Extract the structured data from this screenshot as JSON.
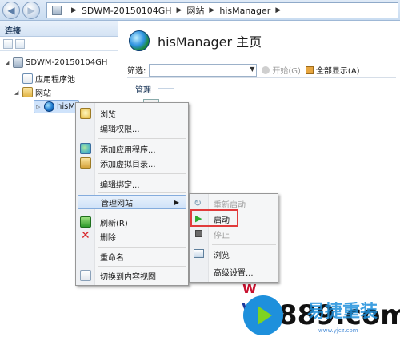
{
  "address_bar": {
    "segments": [
      "SDWM-20150104GH",
      "网站",
      "hisManager"
    ]
  },
  "connections_panel": {
    "title": "连接",
    "tree": [
      {
        "label": "SDWM-20150104GH",
        "icon": "server-icon"
      },
      {
        "label": "应用程序池",
        "icon": "app-pool-icon"
      },
      {
        "label": "网站",
        "icon": "sites-folder-icon"
      },
      {
        "label": "hisM",
        "icon": "globe-icon"
      }
    ]
  },
  "main": {
    "title": "hisManager 主页",
    "filter_label": "筛选:",
    "start_label": "开始(G)",
    "show_all_label": "全部显示(A)",
    "section_label": "管理"
  },
  "context_menu": {
    "items": [
      {
        "label": "浏览",
        "icon": "browse-icon"
      },
      {
        "label": "编辑权限...",
        "icon": ""
      },
      {
        "label": "添加应用程序...",
        "icon": "add-application-icon"
      },
      {
        "label": "添加虚拟目录...",
        "icon": "add-virtual-directory-icon"
      },
      {
        "label": "编辑绑定...",
        "icon": ""
      },
      {
        "label": "管理网站",
        "icon": "",
        "submenu": true
      },
      {
        "label": "刷新(R)",
        "icon": "refresh-icon"
      },
      {
        "label": "删除",
        "icon": "delete-icon"
      },
      {
        "label": "重命名",
        "icon": ""
      },
      {
        "label": "切换到内容视图",
        "icon": "content-view-icon"
      }
    ]
  },
  "submenu": {
    "items": [
      {
        "label": "重新启动",
        "icon": "restart-icon",
        "disabled": true
      },
      {
        "label": "启动",
        "icon": "start-icon",
        "disabled": false
      },
      {
        "label": "停止",
        "icon": "stop-icon",
        "disabled": true
      },
      {
        "label": "浏览",
        "icon": "browse-icon",
        "disabled": false
      },
      {
        "label": "高级设置...",
        "icon": "",
        "disabled": false
      }
    ]
  },
  "watermark": {
    "brand": "it889.com",
    "cn_name": "易捷重装",
    "url": "www.yjcz.com"
  },
  "colors": {
    "highlight": "#e13b3b",
    "accent": "#1e90dc"
  }
}
